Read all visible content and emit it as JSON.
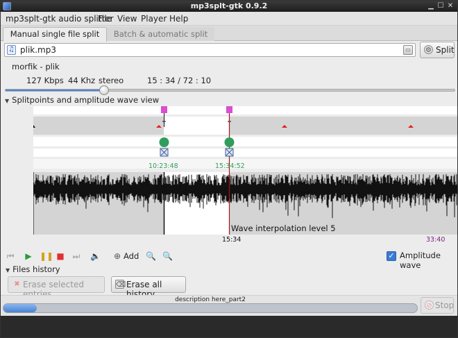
{
  "window": {
    "title": "mp3splt-gtk 0.9.2"
  },
  "menubar": {
    "app_label": "mp3splt-gtk audio splitter",
    "file": "File",
    "view": "View",
    "player": "Player",
    "help": "Help"
  },
  "tabs": [
    {
      "label": "Manual single file split",
      "active": true
    },
    {
      "label": "Batch & automatic split",
      "active": false
    }
  ],
  "file": {
    "name": "plik.mp3",
    "split_label": "Split"
  },
  "track": {
    "artist_title": "morfik - plik",
    "bitrate": "127 Kbps",
    "frequency": "44 Khz",
    "mode": "stereo",
    "time": "15 : 34 / 72 : 10"
  },
  "seek": {
    "fraction": 0.218
  },
  "splitpoints_view": {
    "label": "Splitpoints and amplitude wave view",
    "splitpoints": [
      {
        "time": "10:23:48",
        "color": "#2f9e5a"
      },
      {
        "time": "15:34:52",
        "color": "#2f9e5a"
      }
    ],
    "wave_caption": "Wave interpolation level 5",
    "current_time": "15:34",
    "end_time": "33:40",
    "end_time_color": "#7a1f7a"
  },
  "player": {
    "add_label": "Add",
    "amplitude_wave_label": "Amplitude wave",
    "amplitude_wave_checked": true
  },
  "files_history": {
    "label": "Files history",
    "erase_selected_label": "Erase selected entries",
    "erase_all_label": "Erase all history"
  },
  "status": {
    "description": "description here_part2",
    "progress_fraction": 0.08,
    "stop_label": "Stop"
  },
  "colors": {
    "accent": "#3a7bd5",
    "marker_pink": "#d94fd1",
    "marker_red": "#e02020"
  }
}
